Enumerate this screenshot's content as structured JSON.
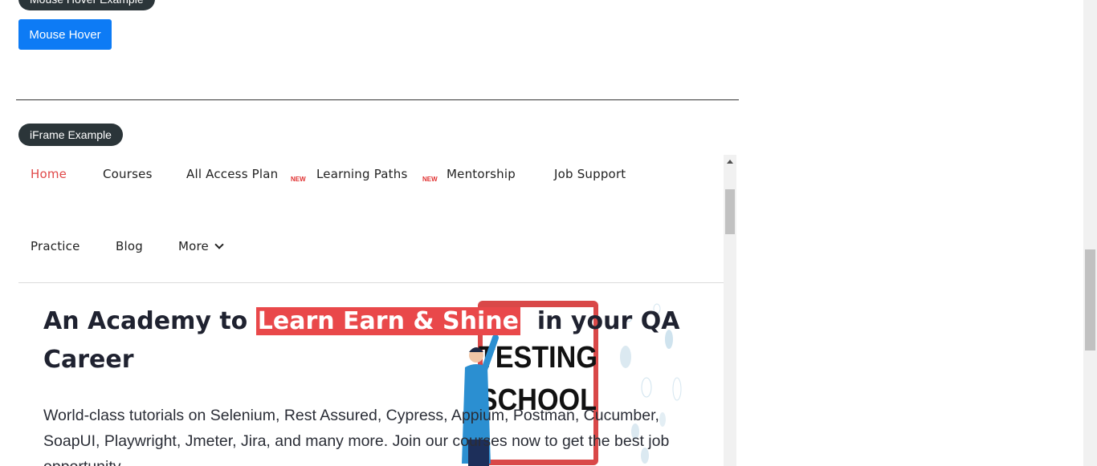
{
  "top_section": {
    "badge_label": "Mouse Hover Example",
    "button_label": "Mouse Hover"
  },
  "iframe_section": {
    "badge_label": "iFrame Example"
  },
  "iframe": {
    "nav": {
      "home": "Home",
      "courses": "Courses",
      "all_access": "All Access Plan",
      "all_access_tag": "NEW",
      "learning_paths": "Learning Paths",
      "learning_paths_tag": "NEW",
      "mentorship": "Mentorship",
      "job_support": "Job Support",
      "practice": "Practice",
      "blog": "Blog",
      "more": "More"
    },
    "hero": {
      "title_prefix": "An Academy to ",
      "title_highlight": "Learn Earn & Shine",
      "title_suffix": "  in your QA Career",
      "description": "World-class tutorials on Selenium, Rest Assured, Cypress, Appium, Postman, Cucumber, SoapUI, Playwright, Jmeter, Jira, and many more. Join our courses now to get the best job opportunity",
      "image_text_line1": "TESTING",
      "image_text_line2": "SCHOOL"
    }
  },
  "colors": {
    "badge_bg": "#2b3539",
    "button_bg": "#0d7bf5",
    "nav_active": "#e04848",
    "highlight": "#e9484a"
  }
}
